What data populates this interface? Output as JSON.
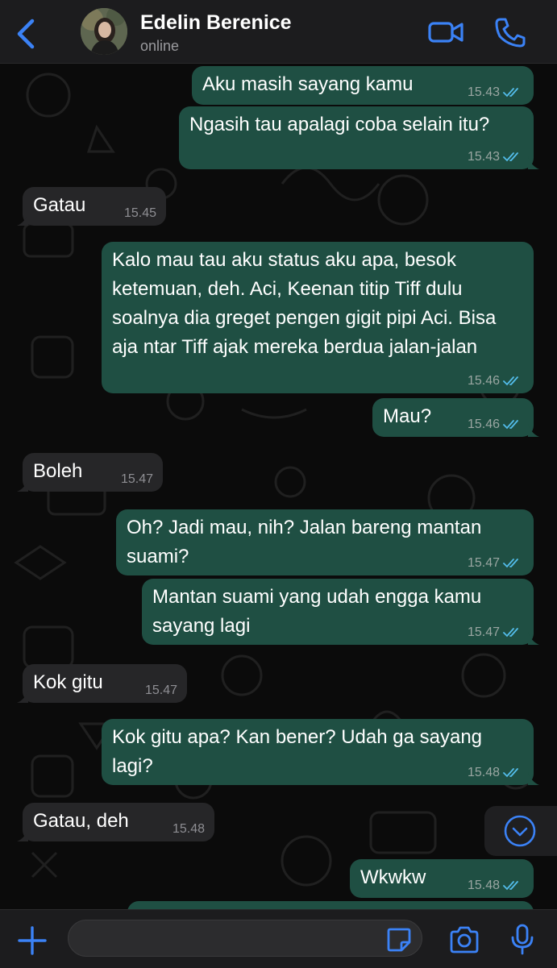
{
  "header": {
    "contact_name": "Edelin Berenice",
    "status": "online"
  },
  "messages": [
    {
      "direction": "out",
      "text": "Aku masih sayang kamu",
      "time": "15.43",
      "read": true
    },
    {
      "direction": "out",
      "text": "Ngasih tau apalagi coba selain itu?",
      "time": "15.43",
      "read": true
    },
    {
      "direction": "in",
      "text": "Gatau",
      "time": "15.45"
    },
    {
      "direction": "out",
      "text": "Kalo mau tau aku status aku apa, besok ketemuan, deh. Aci, Keenan titip Tiff dulu soalnya dia greget pengen gigit pipi Aci. Bisa aja ntar Tiff ajak mereka berdua jalan-jalan",
      "time": "15.46",
      "read": true
    },
    {
      "direction": "out",
      "text": "Mau?",
      "time": "15.46",
      "read": true
    },
    {
      "direction": "in",
      "text": "Boleh",
      "time": "15.47"
    },
    {
      "direction": "out",
      "text": "Oh? Jadi mau, nih? Jalan bareng mantan suami?",
      "time": "15.47",
      "read": true
    },
    {
      "direction": "out",
      "text": "Mantan suami yang udah engga kamu sayang lagi",
      "time": "15.47",
      "read": true
    },
    {
      "direction": "in",
      "text": "Kok gitu",
      "time": "15.47"
    },
    {
      "direction": "out",
      "text": "Kok gitu apa? Kan bener? Udah ga sayang lagi?",
      "time": "15.48",
      "read": true
    },
    {
      "direction": "in",
      "text": "Gatau, deh",
      "time": "15.48"
    },
    {
      "direction": "out",
      "text": "Wkwkw",
      "time": "15.48",
      "read": true
    }
  ],
  "input": {
    "value": "",
    "placeholder": ""
  },
  "colors": {
    "outgoing_bubble": "#1f4f43",
    "incoming_bubble": "#262628",
    "accent": "#3b82f6",
    "read_ticks": "#53bdeb"
  },
  "icons": [
    "back-chevron-icon",
    "video-camera-icon",
    "phone-icon",
    "chevron-down-circle-icon",
    "plus-icon",
    "sticker-icon",
    "camera-icon",
    "microphone-icon"
  ]
}
